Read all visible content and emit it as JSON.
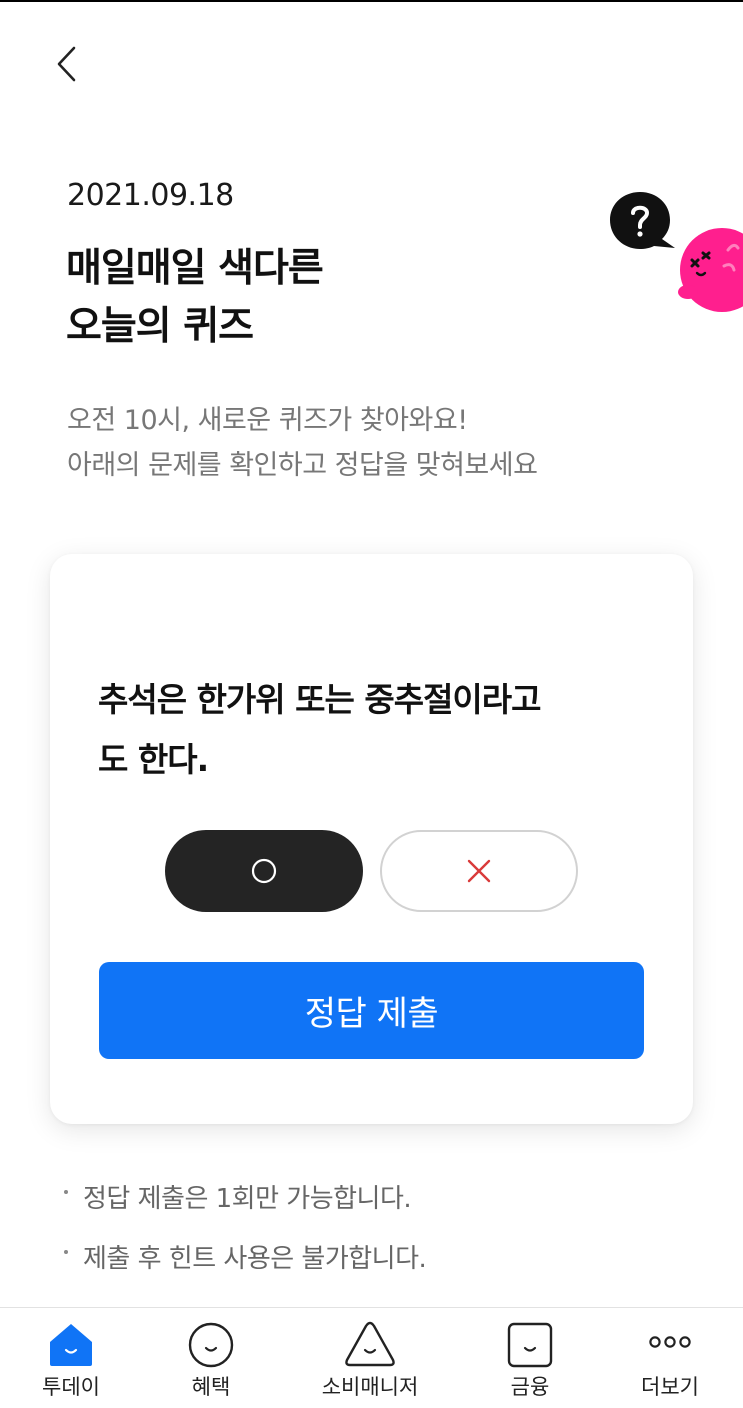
{
  "header": {
    "date": "2021.09.18",
    "title_line1": "매일매일 색다른",
    "title_line2": "오늘의 퀴즈",
    "desc_line1": "오전 10시, 새로운 퀴즈가 찾아와요!",
    "desc_line2": "아래의 문제를 확인하고 정답을 맞혀보세요"
  },
  "quiz": {
    "question_line1": "추석은 한가위 또는 중추절이라고",
    "question_line2": "도 한다.",
    "options": [
      {
        "symbol": "○",
        "selected": true
      },
      {
        "symbol": "×",
        "selected": false
      }
    ],
    "submit_label": "정답 제출"
  },
  "notes": [
    "정답 제출은 1회만 가능합니다.",
    "제출 후 힌트 사용은 불가합니다."
  ],
  "tabs": [
    {
      "label": "투데이",
      "icon": "home-icon",
      "active": true
    },
    {
      "label": "혜택",
      "icon": "smile-circle-icon",
      "active": false
    },
    {
      "label": "소비매니저",
      "icon": "smile-triangle-icon",
      "active": false
    },
    {
      "label": "금융",
      "icon": "smile-square-icon",
      "active": false
    },
    {
      "label": "더보기",
      "icon": "more-dots-icon",
      "active": false
    }
  ],
  "colors": {
    "accent": "#1074f6",
    "selected_option": "#242424",
    "x_mark": "#d93a3a",
    "mascot": "#ff1f8e"
  }
}
